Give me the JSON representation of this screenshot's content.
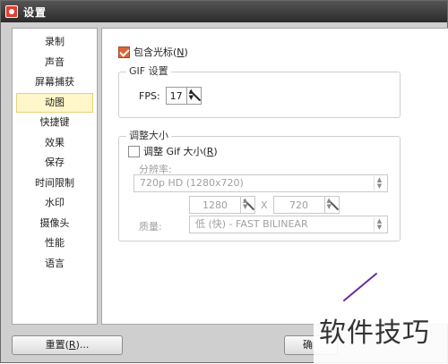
{
  "window": {
    "title": "设置"
  },
  "sidebar": {
    "items": [
      {
        "label": "录制"
      },
      {
        "label": "声音"
      },
      {
        "label": "屏幕捕获"
      },
      {
        "label": "动图",
        "selected": true
      },
      {
        "label": "快捷键"
      },
      {
        "label": "效果"
      },
      {
        "label": "保存"
      },
      {
        "label": "时间限制"
      },
      {
        "label": "水印"
      },
      {
        "label": "摄像头"
      },
      {
        "label": "性能"
      },
      {
        "label": "语言"
      }
    ]
  },
  "gif": {
    "include_cursor": {
      "label": "包含光标(",
      "accel": "N",
      "suffix": ")",
      "checked": true
    },
    "group_title": "GIF 设置",
    "fps_label": "FPS:",
    "fps_value": "17"
  },
  "resize": {
    "group_title": "调整大小",
    "check_label": "调整 Gif 大小(",
    "check_accel": "R",
    "check_suffix": ")",
    "checked": false,
    "resolution_label": "分辨率:",
    "resolution_value": "720p HD (1280x720)",
    "width": "1280",
    "times": "X",
    "height": "720",
    "quality_label": "质量:",
    "quality_value": "低 (快) - FAST BILINEAR"
  },
  "buttons": {
    "reset_label": "重置(",
    "reset_accel": "R",
    "reset_suffix": ")...",
    "ok_label": "确"
  },
  "watermark": {
    "text": "软件技巧"
  },
  "colors": {
    "accent_check": "#d9663a",
    "selected_item_bg": "#fff6c9",
    "annotation_stroke": "#6b2aa0"
  }
}
